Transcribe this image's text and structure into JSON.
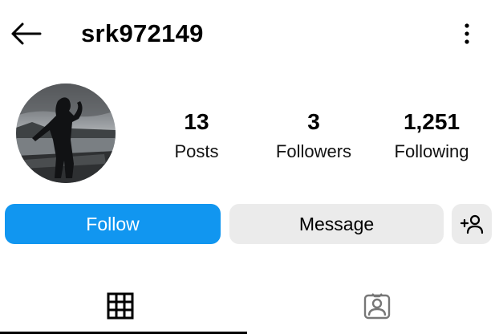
{
  "header": {
    "back_icon": "arrow-left-icon",
    "username": "srk972149",
    "more_icon": "vertical-ellipsis-icon"
  },
  "profile": {
    "avatar": "profile-photo",
    "stats": [
      {
        "value": "13",
        "label": "Posts"
      },
      {
        "value": "3",
        "label": "Followers"
      },
      {
        "value": "1,251",
        "label": "Following"
      }
    ]
  },
  "actions": {
    "follow_label": "Follow",
    "message_label": "Message",
    "suggest_icon": "add-person-icon",
    "follow_color": "#1196f0",
    "secondary_color": "#ebebeb"
  },
  "tabs": [
    {
      "icon": "grid-icon",
      "active": true
    },
    {
      "icon": "tagged-person-icon",
      "active": false
    }
  ]
}
